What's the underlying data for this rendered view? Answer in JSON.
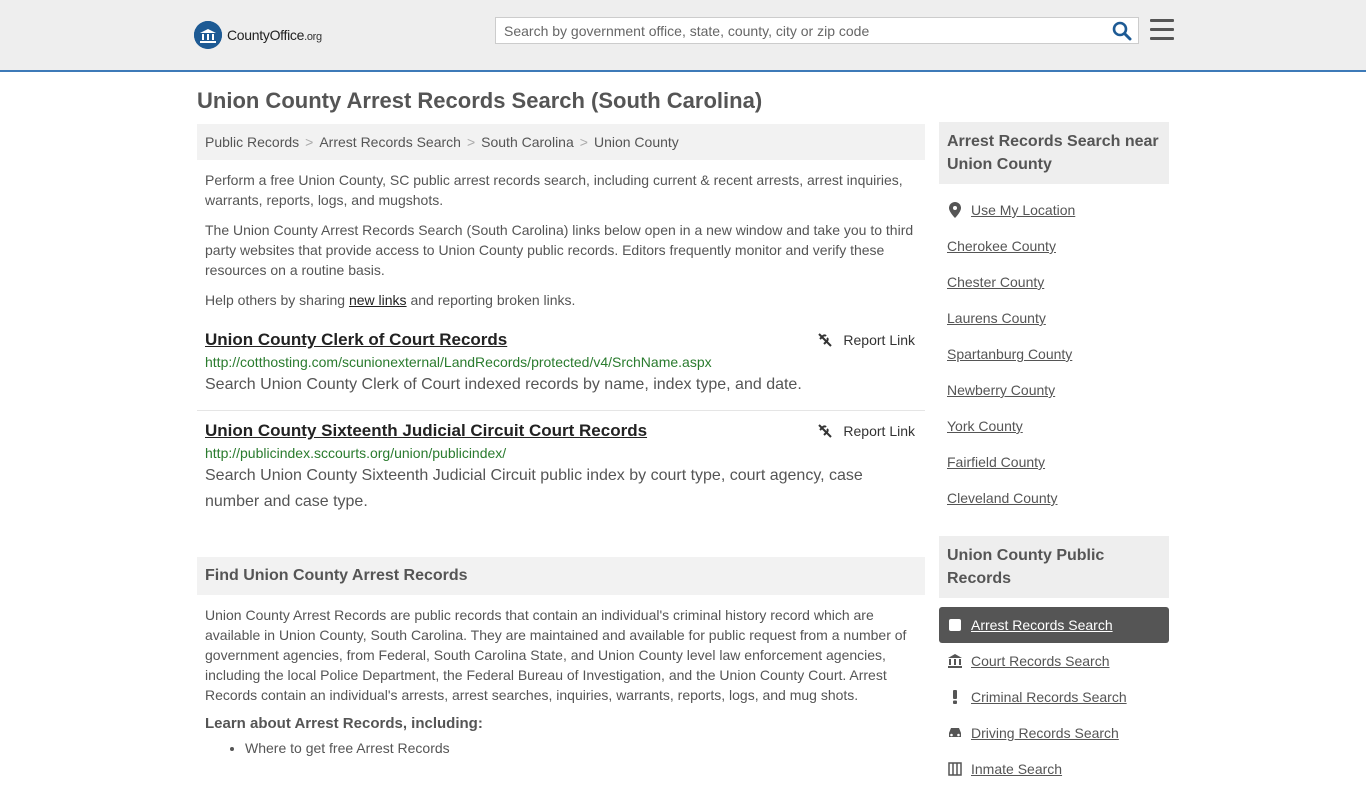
{
  "header": {
    "logo_county": "County",
    "logo_office": "Office",
    "logo_org": ".org",
    "search_placeholder": "Search by government office, state, county, city or zip code"
  },
  "page_title": "Union County Arrest Records Search (South Carolina)",
  "breadcrumb": [
    "Public Records",
    "Arrest Records Search",
    "South Carolina",
    "Union County"
  ],
  "intro": {
    "p1": "Perform a free Union County, SC public arrest records search, including current & recent arrests, arrest inquiries, warrants, reports, logs, and mugshots.",
    "p2": "The Union County Arrest Records Search (South Carolina) links below open in a new window and take you to third party websites that provide access to Union County public records. Editors frequently monitor and verify these resources on a routine basis.",
    "p3_before": "Help others by sharing ",
    "p3_link": "new links",
    "p3_after": " and reporting broken links."
  },
  "records": [
    {
      "title": "Union County Clerk of Court Records",
      "url": "http://cotthosting.com/scunionexternal/LandRecords/protected/v4/SrchName.aspx",
      "desc": "Search Union County Clerk of Court indexed records by name, index type, and date.",
      "report": "Report Link"
    },
    {
      "title": "Union County Sixteenth Judicial Circuit Court Records",
      "url": "http://publicindex.sccourts.org/union/publicindex/",
      "desc": "Search Union County Sixteenth Judicial Circuit public index by court type, court agency, case number and case type.",
      "report": "Report Link"
    }
  ],
  "find": {
    "heading": "Find Union County Arrest Records",
    "text": "Union County Arrest Records are public records that contain an individual's criminal history record which are available in Union County, South Carolina. They are maintained and available for public request from a number of government agencies, from Federal, South Carolina State, and Union County level law enforcement agencies, including the local Police Department, the Federal Bureau of Investigation, and the Union County Court. Arrest Records contain an individual's arrests, arrest searches, inquiries, warrants, reports, logs, and mug shots.",
    "learn_heading": "Learn about Arrest Records, including:",
    "learn_items": [
      "Where to get free Arrest Records"
    ]
  },
  "sidebar": {
    "nearby_heading": "Arrest Records Search near Union County",
    "use_location": "Use My Location",
    "nearby": [
      "Cherokee County",
      "Chester County",
      "Laurens County",
      "Spartanburg County",
      "Newberry County",
      "York County",
      "Fairfield County",
      "Cleveland County"
    ],
    "public_heading": "Union County Public Records",
    "public": [
      {
        "label": "Arrest Records Search",
        "icon": "checkbox-icon",
        "active": true
      },
      {
        "label": "Court Records Search",
        "icon": "courthouse-icon"
      },
      {
        "label": "Criminal Records Search",
        "icon": "exclamation-icon"
      },
      {
        "label": "Driving Records Search",
        "icon": "car-icon"
      },
      {
        "label": "Inmate Search",
        "icon": "inmate-icon"
      }
    ]
  }
}
